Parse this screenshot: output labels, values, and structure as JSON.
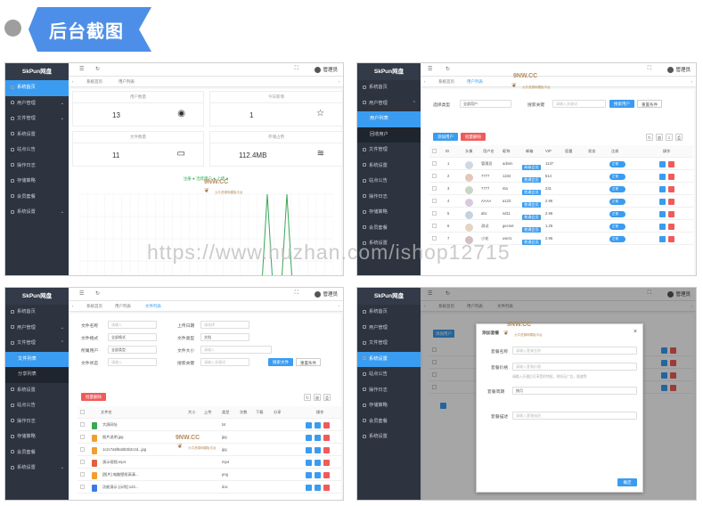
{
  "header": {
    "banner": "后台截图"
  },
  "common": {
    "logo": "SkPun网盘",
    "user": "管理员",
    "tab_home": "系统首页",
    "tab_users": "用户列表",
    "tab_files": "文件列表",
    "watermark": "9NW.CC",
    "watermark_sub": "九牛资源网模板平台",
    "url": "https://www.huzhan.com/ishop12715",
    "menu": [
      "系统首页",
      "用户管理",
      "文件管理",
      "系统设置",
      "站点公告",
      "操作日志",
      "存储策略",
      "会员套餐",
      "系统设置"
    ],
    "sub_users": [
      "用户列表",
      "回收用户"
    ],
    "sub_files": [
      "文件列表",
      "分享列表"
    ]
  },
  "dashboard": {
    "cards": [
      {
        "cap": "用户数量",
        "value": "13",
        "icon": "user-circle-icon"
      },
      {
        "cap": "今日新增",
        "value": "1",
        "icon": "star-icon"
      },
      {
        "cap": "文件数量",
        "value": "11",
        "icon": "folder-icon"
      },
      {
        "cap": "存储占用",
        "value": "112.4MB",
        "icon": "layers-icon"
      }
    ],
    "legend": "注册 ● 活跃用户 ● 上传 ●"
  },
  "users": {
    "search_label": "选择类型",
    "search_select": "全部用户",
    "keyword_label": "搜索关键",
    "keyword_ph": "请输入关键词",
    "search_btn": "搜索用户",
    "reset_btn": "重置条件",
    "add_btn": "添加用户",
    "del_btn": "批量删除",
    "columns": [
      "ID",
      "头像",
      "用户名",
      "昵称",
      "邮箱",
      "VIP",
      "容量",
      "状态",
      "注册",
      "操作"
    ],
    "rows": [
      {
        "id": "1",
        "name": "管理员",
        "nick": "admin",
        "tag": "高级会员",
        "size": "1137"
      },
      {
        "id": "2",
        "name": "7777",
        "nick": "1234",
        "tag": "普通会员",
        "size": "514"
      },
      {
        "id": "3",
        "name": "7777",
        "nick": "rita",
        "tag": "普通会员",
        "size": "231"
      },
      {
        "id": "4",
        "name": "AAAA",
        "nick": "a123",
        "tag": "普通会员",
        "size": "2.96"
      },
      {
        "id": "5",
        "name": "abc",
        "nick": "sd11",
        "tag": "普通会员",
        "size": "2.96"
      },
      {
        "id": "6",
        "name": "测试",
        "nick": "gecnet",
        "tag": "普通会员",
        "size": "1.26"
      },
      {
        "id": "7",
        "name": "小花",
        "nick": "user1",
        "tag": "普通会员",
        "size": "2.96"
      }
    ],
    "status": "正常"
  },
  "files": {
    "labels": [
      "文件名称",
      "上传日期",
      "文件格式",
      "文件类型",
      "所属用户",
      "文件大小",
      "文件状态",
      "搜索关键"
    ],
    "selects": [
      "全部格式",
      "文档",
      "全部类型"
    ],
    "placeholders": [
      "请输入",
      "请选择",
      "请输入",
      "请输入",
      "请输入关键词"
    ],
    "search_btn": "搜索文件",
    "reset_btn": "重置条件",
    "del_btn": "批量删除",
    "columns": [
      "文件名",
      "大小",
      "上传",
      "类型",
      "次数",
      "下载",
      "分享",
      "操作"
    ],
    "rows": [
      {
        "name": "大屏网址",
        "kind": "txt"
      },
      {
        "name": "图片说明.jpg",
        "kind": "jpg"
      },
      {
        "name": "1c2c7a5f8a0b3b2c2d...jpg",
        "kind": "jpg"
      },
      {
        "name": "演示视频.mp4",
        "kind": "mp4"
      },
      {
        "name": "[图片] 电脑壁纸高清...",
        "kind": "png"
      },
      {
        "name": "功能演示 [示例] 123...",
        "kind": "doc"
      }
    ]
  },
  "modal": {
    "title": "添加套餐",
    "fields": [
      "套餐名称",
      "套餐价格",
      "套餐周期",
      "套餐描述"
    ],
    "placeholders": [
      "请输入套餐名称",
      "请输入套餐价格",
      "请输入套餐描述"
    ],
    "cycle": "按月",
    "hint": "请输入开通后可享受的特权，例如无广告，限速等",
    "confirm": "确定"
  }
}
